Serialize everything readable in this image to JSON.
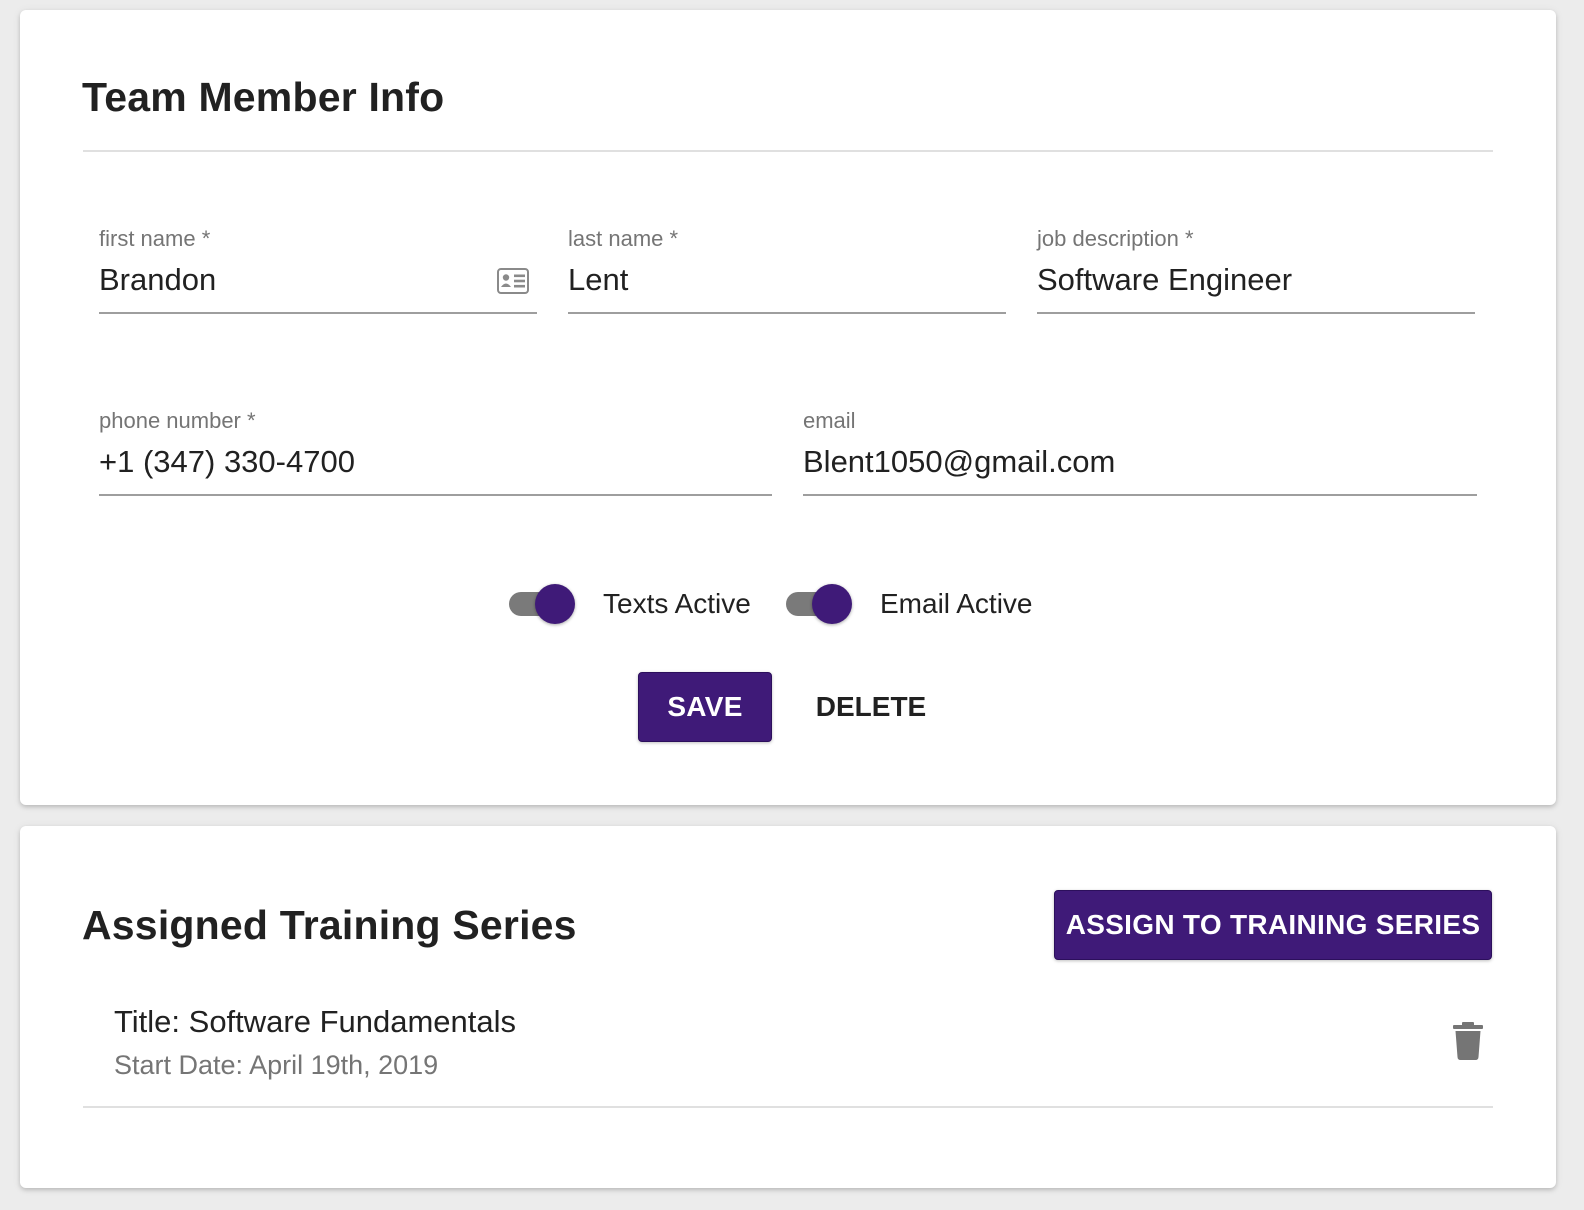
{
  "team_member_info": {
    "title": "Team Member Info",
    "fields": {
      "first_name": {
        "label": "first name *",
        "value": "Brandon",
        "icon": "contact-card-icon"
      },
      "last_name": {
        "label": "last name *",
        "value": "Lent"
      },
      "job_description": {
        "label": "job description *",
        "value": "Software Engineer"
      },
      "phone_number": {
        "label": "phone number *",
        "value": "+1 (347) 330-4700"
      },
      "email": {
        "label": "email",
        "value": "Blent1050@gmail.com"
      }
    },
    "toggles": {
      "texts_active": {
        "label": "Texts Active",
        "checked": true
      },
      "email_active": {
        "label": "Email Active",
        "checked": true
      }
    },
    "actions": {
      "save_label": "SAVE",
      "delete_label": "DELETE"
    }
  },
  "assigned_training": {
    "title": "Assigned Training Series",
    "assign_button_label": "ASSIGN TO TRAINING SERIES",
    "items": [
      {
        "title": "Title: Software Fundamentals",
        "start_date": "Start Date: April 19th, 2019",
        "icon": "trash-icon"
      }
    ]
  },
  "colors": {
    "primary": "#3f1a78",
    "toggle_track": "#7a7a7a",
    "label_gray": "#757575",
    "text": "#212121"
  }
}
